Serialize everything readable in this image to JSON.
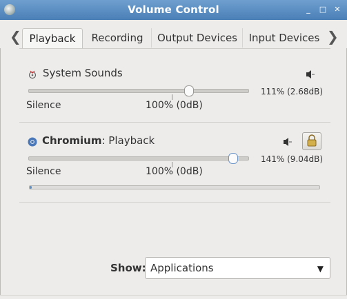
{
  "window": {
    "title": "Volume Control",
    "buttons": {
      "minimize": "_",
      "maximize": "□",
      "close": "✕"
    }
  },
  "tabs": {
    "items": [
      {
        "label": "Playback",
        "active": true
      },
      {
        "label": "Recording",
        "active": false
      },
      {
        "label": "Output Devices",
        "active": false
      },
      {
        "label": "Input Devices",
        "active": false
      }
    ],
    "left_arrow": "❮",
    "right_arrow": "❯"
  },
  "streams": [
    {
      "name": "System Sounds",
      "app": "",
      "detail": "",
      "icon": "system-sounds-icon",
      "volume_percent": 111,
      "volume_text": "111% (2.68dB)",
      "slider_mark_left": "Silence",
      "slider_mark_center": "100% (0dB)"
    },
    {
      "name": "",
      "app": "Chromium",
      "detail": ": Playback",
      "icon": "chromium-icon",
      "volume_percent": 141,
      "volume_text": "141% (9.04dB)",
      "slider_mark_left": "Silence",
      "slider_mark_center": "100% (0dB)",
      "meter_level": 0.01
    }
  ],
  "footer": {
    "show_label": "Show:",
    "show_value": "Applications"
  },
  "colors": {
    "titlebar_top": "#6f9fcf",
    "titlebar_bottom": "#4a7fb6",
    "background": "#edeceb",
    "meter_accent": "#5b8fc7"
  }
}
